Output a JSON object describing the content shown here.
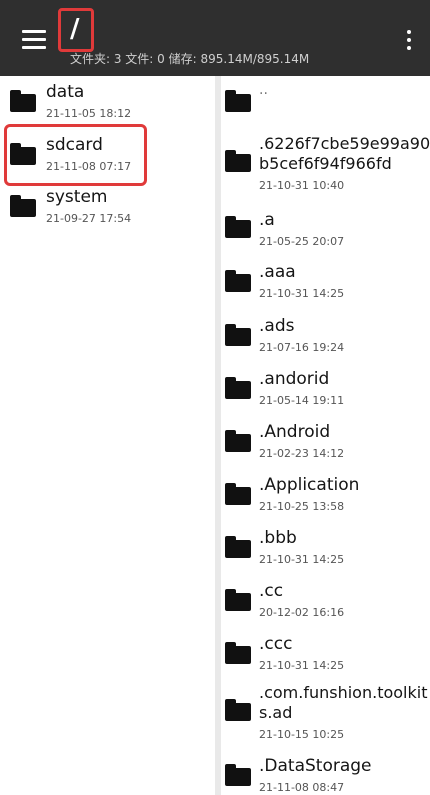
{
  "header": {
    "path": "/",
    "stats": "文件夹: 3  文件: 0  储存: 895.14M/895.14M"
  },
  "left_pane": {
    "items": [
      {
        "name": "data",
        "date": "21-11-05 18:12"
      },
      {
        "name": "sdcard",
        "date": "21-11-08 07:17"
      },
      {
        "name": "system",
        "date": "21-09-27 17:54"
      }
    ]
  },
  "right_pane": {
    "parent": "..",
    "items": [
      {
        "name_line1": ".6226f7cbe59e99a90",
        "name_line2": "b5cef6f94f966fd",
        "date": "21-10-31 10:40"
      },
      {
        "name": ".a",
        "date": "21-05-25 20:07"
      },
      {
        "name": ".aaa",
        "date": "21-10-31 14:25"
      },
      {
        "name": ".ads",
        "date": "21-07-16 19:24"
      },
      {
        "name": ".andorid",
        "date": "21-05-14 19:11"
      },
      {
        "name": ".Android",
        "date": "21-02-23 14:12"
      },
      {
        "name": ".Application",
        "date": "21-10-25 13:58"
      },
      {
        "name": ".bbb",
        "date": "21-10-31 14:25"
      },
      {
        "name": ".cc",
        "date": "20-12-02 16:16"
      },
      {
        "name": ".ccc",
        "date": "21-10-31 14:25"
      },
      {
        "name_line1": ".com.funshion.toolkit",
        "name_line2": "s.ad",
        "date": "21-10-15 10:25"
      },
      {
        "name": ".DataStorage",
        "date": "21-11-08 08:47"
      }
    ]
  },
  "colors": {
    "toolbar": "#2f2f2f",
    "highlight": "#e03a3a",
    "folder": "#111111"
  },
  "icons": {
    "menu": "hamburger-menu-icon",
    "more": "more-vertical-icon",
    "folder": "folder-icon"
  }
}
